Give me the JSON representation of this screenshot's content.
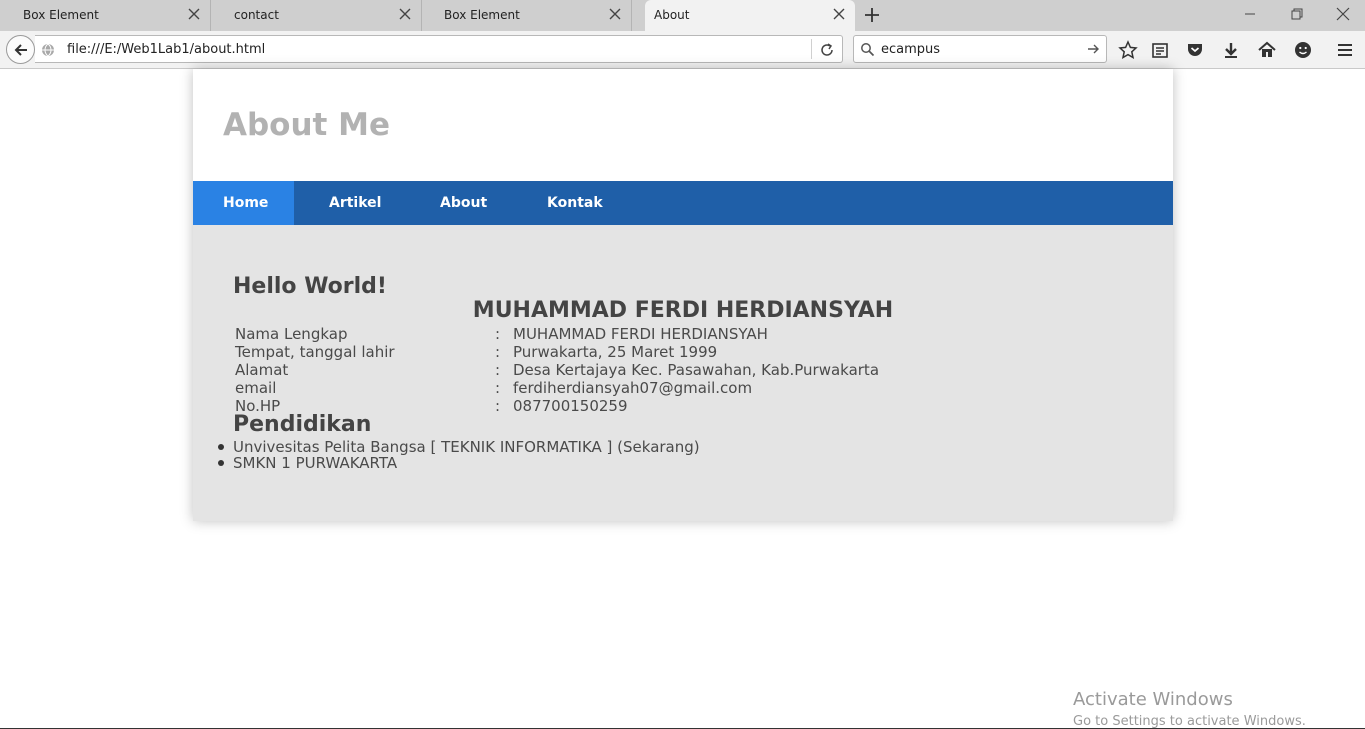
{
  "browser": {
    "tabs": [
      {
        "title": "Box Element"
      },
      {
        "title": "contact"
      },
      {
        "title": "Box Element"
      },
      {
        "title": "About"
      }
    ],
    "url": "file:///E:/Web1Lab1/about.html",
    "search_value": "ecampus"
  },
  "site": {
    "title": "About Me",
    "menu": [
      "Home",
      "Artikel",
      "About",
      "Kontak"
    ],
    "active_menu": "Home"
  },
  "content": {
    "greeting": "Hello World!",
    "full_name": "MUHAMMAD FERDI HERDIANSYAH",
    "bio": [
      {
        "label": "Nama Lengkap",
        "value": "MUHAMMAD FERDI HERDIANSYAH"
      },
      {
        "label": "Tempat, tanggal lahir",
        "value": "Purwakarta, 25 Maret 1999"
      },
      {
        "label": "Alamat",
        "value": "Desa Kertajaya Kec. Pasawahan, Kab.Purwakarta"
      },
      {
        "label": "email",
        "value": "ferdiherdiansyah07@gmail.com"
      },
      {
        "label": "No.HP",
        "value": "087700150259"
      }
    ],
    "colon": ":",
    "education_title": "Pendidikan",
    "education": [
      "Unvivesitas Pelita Bangsa [ TEKNIK INFORMATIKA ] (Sekarang)",
      "SMKN 1 PURWAKARTA"
    ]
  },
  "watermark": {
    "line1": "Activate Windows",
    "line2": "Go to Settings to activate Windows."
  },
  "colors": {
    "menu_bg": "#1f5fa8",
    "menu_active": "#2a82e4",
    "content_bg": "#e4e4e4",
    "title": "#b2b2b2"
  }
}
